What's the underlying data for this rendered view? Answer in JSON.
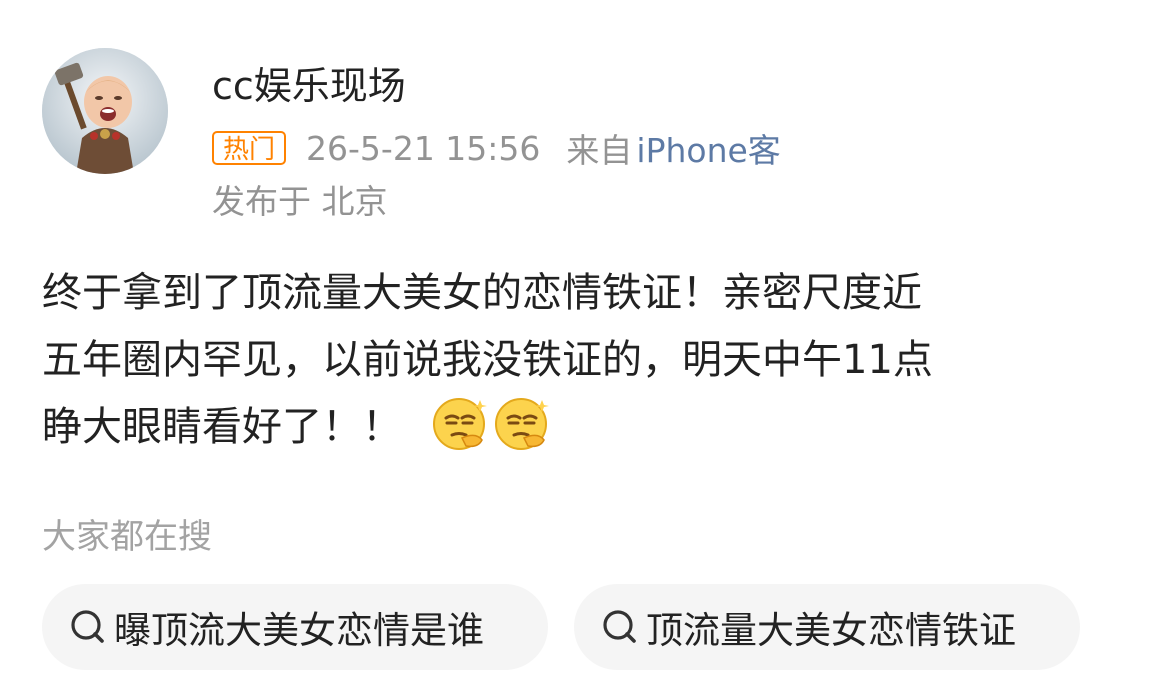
{
  "author": {
    "name": "cc娱乐现场",
    "avatar": "avatar-icon"
  },
  "meta": {
    "badge": "热门",
    "time": "26-5-21 15:56",
    "from_label": "来自",
    "source": "iPhone客",
    "location": "发布于 北京"
  },
  "post": {
    "lines": [
      "终于拿到了顶流量大美女的恋情铁证！亲密尺度近",
      "五年圈内罕见，以前说我没铁证的，明天中午11点",
      "睁大眼睛看好了！！"
    ],
    "emojis": [
      "smirk-emoji",
      "smirk-emoji"
    ]
  },
  "searches": {
    "heading": "大家都在搜",
    "chips": [
      {
        "label": "曝顶流大美女恋情是谁",
        "icon": "search-icon"
      },
      {
        "label": "顶流量大美女恋情铁证",
        "icon": "search-icon"
      }
    ]
  },
  "colors": {
    "badge": "#ff8200",
    "meta_gray": "#939393",
    "source_link": "#5d7aa5",
    "chip_bg": "#f5f5f5"
  }
}
